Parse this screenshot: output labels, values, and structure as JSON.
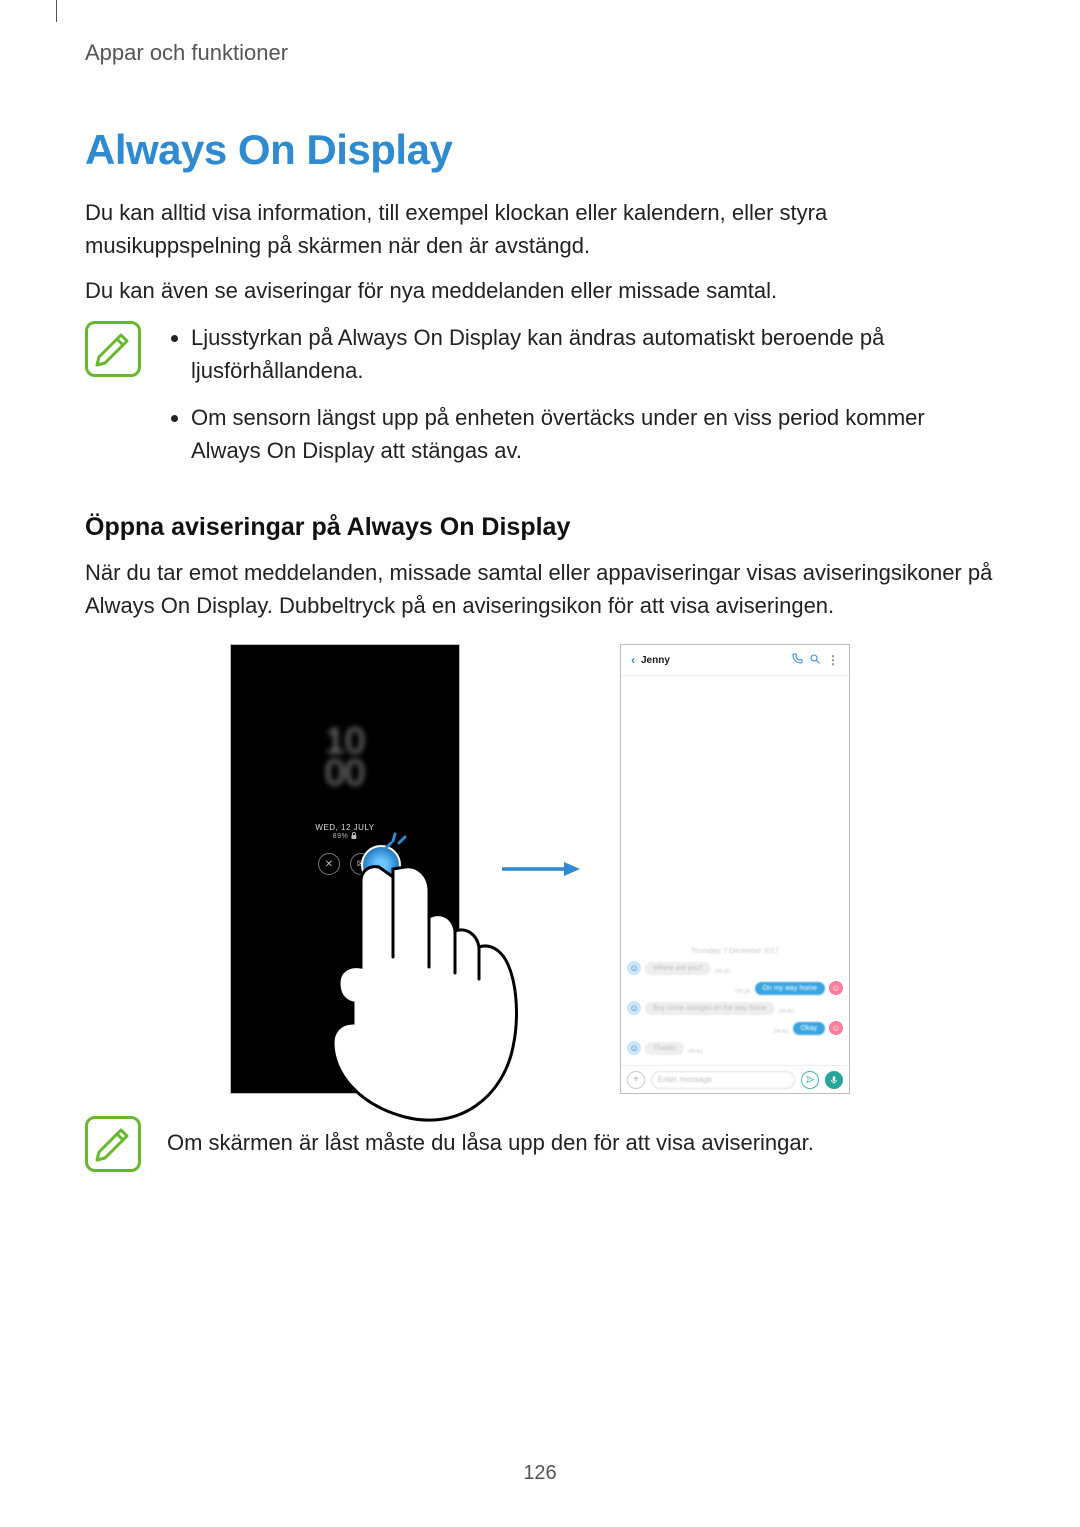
{
  "header": {
    "breadcrumb": "Appar och funktioner"
  },
  "title": "Always On Display",
  "intro_p1": "Du kan alltid visa information, till exempel klockan eller kalendern, eller styra musikuppspelning på skärmen när den är avstängd.",
  "intro_p2": "Du kan även se aviseringar för nya meddelanden eller missade samtal.",
  "note1_items": [
    "Ljusstyrkan på Always On Display kan ändras automatiskt beroende på ljusförhållandena.",
    "Om sensorn längst upp på enheten övertäcks under en viss period kommer Always On Display att stängas av."
  ],
  "subhead": "Öppna aviseringar på Always On Display",
  "subtext": "När du tar emot meddelanden, missade samtal eller appaviseringar visas aviseringsikoner på Always On Display. Dubbeltryck på en aviseringsikon för att visa aviseringen.",
  "figure": {
    "aod": {
      "clock_1": "10",
      "clock_2": "00",
      "date": "WED, 12 JULY",
      "battery": "89%"
    },
    "chat": {
      "contact": "Jenny",
      "date_separator": "Thursday, 7 December 2017",
      "m1": "Where are you?",
      "t1": "09:30",
      "m2": "On my way home",
      "t2": "09:36",
      "m3": "Buy some oranges on the way home",
      "t3": "09:40",
      "m4": "Okay",
      "t4": "09:41",
      "m5": "Thanks",
      "t5": "09:42",
      "input_placeholder": "Enter message"
    }
  },
  "note2_text": "Om skärmen är låst måste du låsa upp den för att visa aviseringar.",
  "page_number": "126",
  "icons": {
    "note": "note-icon",
    "lock": "lock-icon",
    "phone_call": "phone-icon",
    "search": "search-icon",
    "more": "more-icon",
    "back": "back-icon",
    "plus": "plus-icon",
    "send": "send-icon",
    "mic": "mic-icon"
  },
  "colors": {
    "accent": "#2F8AD0",
    "note_green": "#68B82E",
    "chat_blue": "#3aa6e0"
  }
}
